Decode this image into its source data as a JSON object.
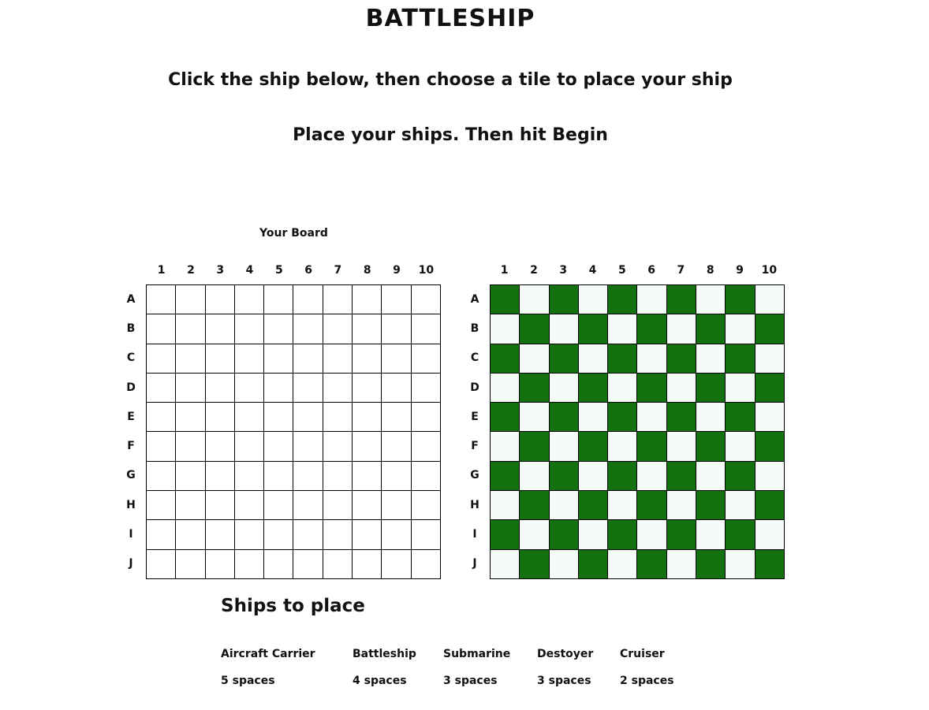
{
  "title": "BATTLESHIP",
  "instructions": {
    "line1": "Click the ship below, then choose a tile to place your ship",
    "line2": "Place your ships. Then hit Begin"
  },
  "player_board": {
    "label": "Your Board",
    "columns": [
      "1",
      "2",
      "3",
      "4",
      "5",
      "6",
      "7",
      "8",
      "9",
      "10"
    ],
    "rows": [
      "A",
      "B",
      "C",
      "D",
      "E",
      "F",
      "G",
      "H",
      "I",
      "J"
    ]
  },
  "enemy_board": {
    "columns": [
      "1",
      "2",
      "3",
      "4",
      "5",
      "6",
      "7",
      "8",
      "9",
      "10"
    ],
    "rows": [
      "A",
      "B",
      "C",
      "D",
      "E",
      "F",
      "G",
      "H",
      "I",
      "J"
    ],
    "pattern": "checkerboard",
    "colors": {
      "dark": "#13720f",
      "light": "#f5fbf6"
    }
  },
  "ships_section": {
    "title": "Ships to place",
    "ships": [
      {
        "name": "Aircraft Carrier",
        "spaces": "5 spaces"
      },
      {
        "name": "Battleship",
        "spaces": "4 spaces"
      },
      {
        "name": "Submarine",
        "spaces": "3 spaces"
      },
      {
        "name": "Destoyer",
        "spaces": "3 spaces"
      },
      {
        "name": "Cruiser",
        "spaces": "2 spaces"
      }
    ]
  }
}
